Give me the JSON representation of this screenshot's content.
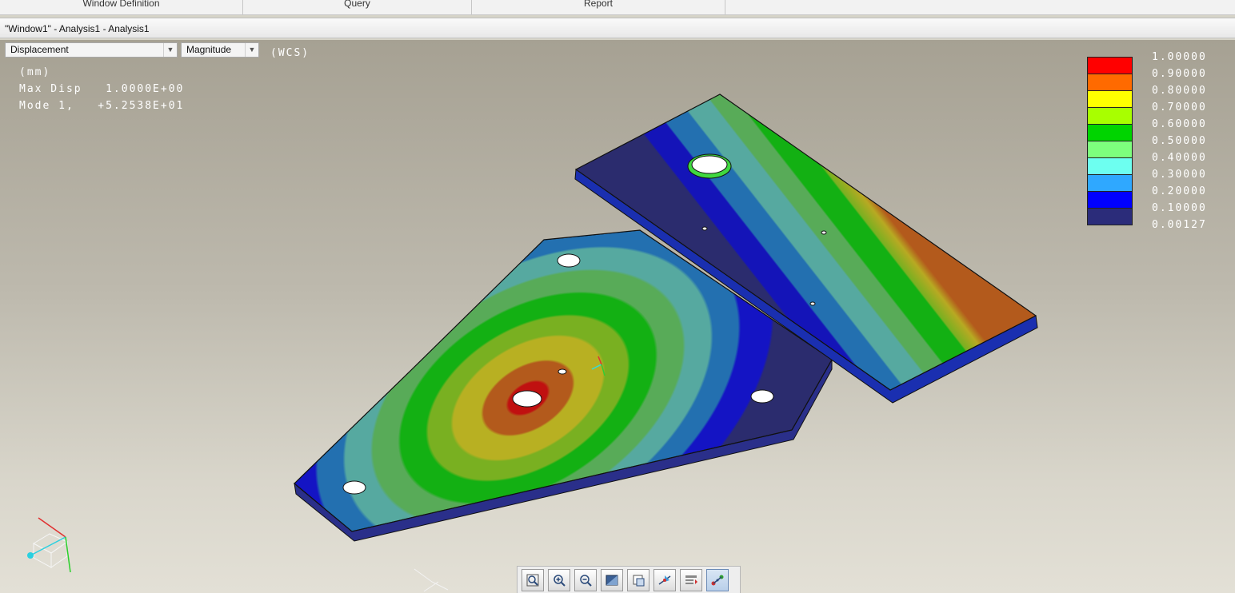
{
  "ribbon": {
    "groups": [
      "Window Definition",
      "Query",
      "Report"
    ]
  },
  "window": {
    "title": "\"Window1\" - Analysis1 - Analysis1"
  },
  "display": {
    "quantity": "Displacement",
    "component": "Magnitude",
    "coord_system": "(WCS)",
    "units": "(mm)",
    "max_disp": "Max Disp   1.0000E+00",
    "mode": "Mode 1,   +5.2538E+01"
  },
  "legend": {
    "values": [
      "1.00000",
      "0.90000",
      "0.80000",
      "0.70000",
      "0.60000",
      "0.50000",
      "0.40000",
      "0.30000",
      "0.20000",
      "0.10000",
      "0.00127"
    ],
    "colors": [
      "#ff0000",
      "#ff6a00",
      "#ffff00",
      "#a8ff00",
      "#00d400",
      "#7dff7d",
      "#6dfff0",
      "#2fa8ff",
      "#0000ff",
      "#2b2c7a"
    ]
  },
  "toolbar": {
    "icons": [
      "zoom-fit-icon",
      "zoom-in-icon",
      "zoom-out-icon",
      "shaded-display-icon",
      "view-orientation-icon",
      "spin-center-icon",
      "model-display-icon",
      "datum-display-icon"
    ]
  },
  "colors": {
    "viewport_top": "#a6a193",
    "viewport_bottom": "#e3e0d6",
    "contour_max": "#ff0000",
    "contour_min": "#2b2c7a"
  }
}
